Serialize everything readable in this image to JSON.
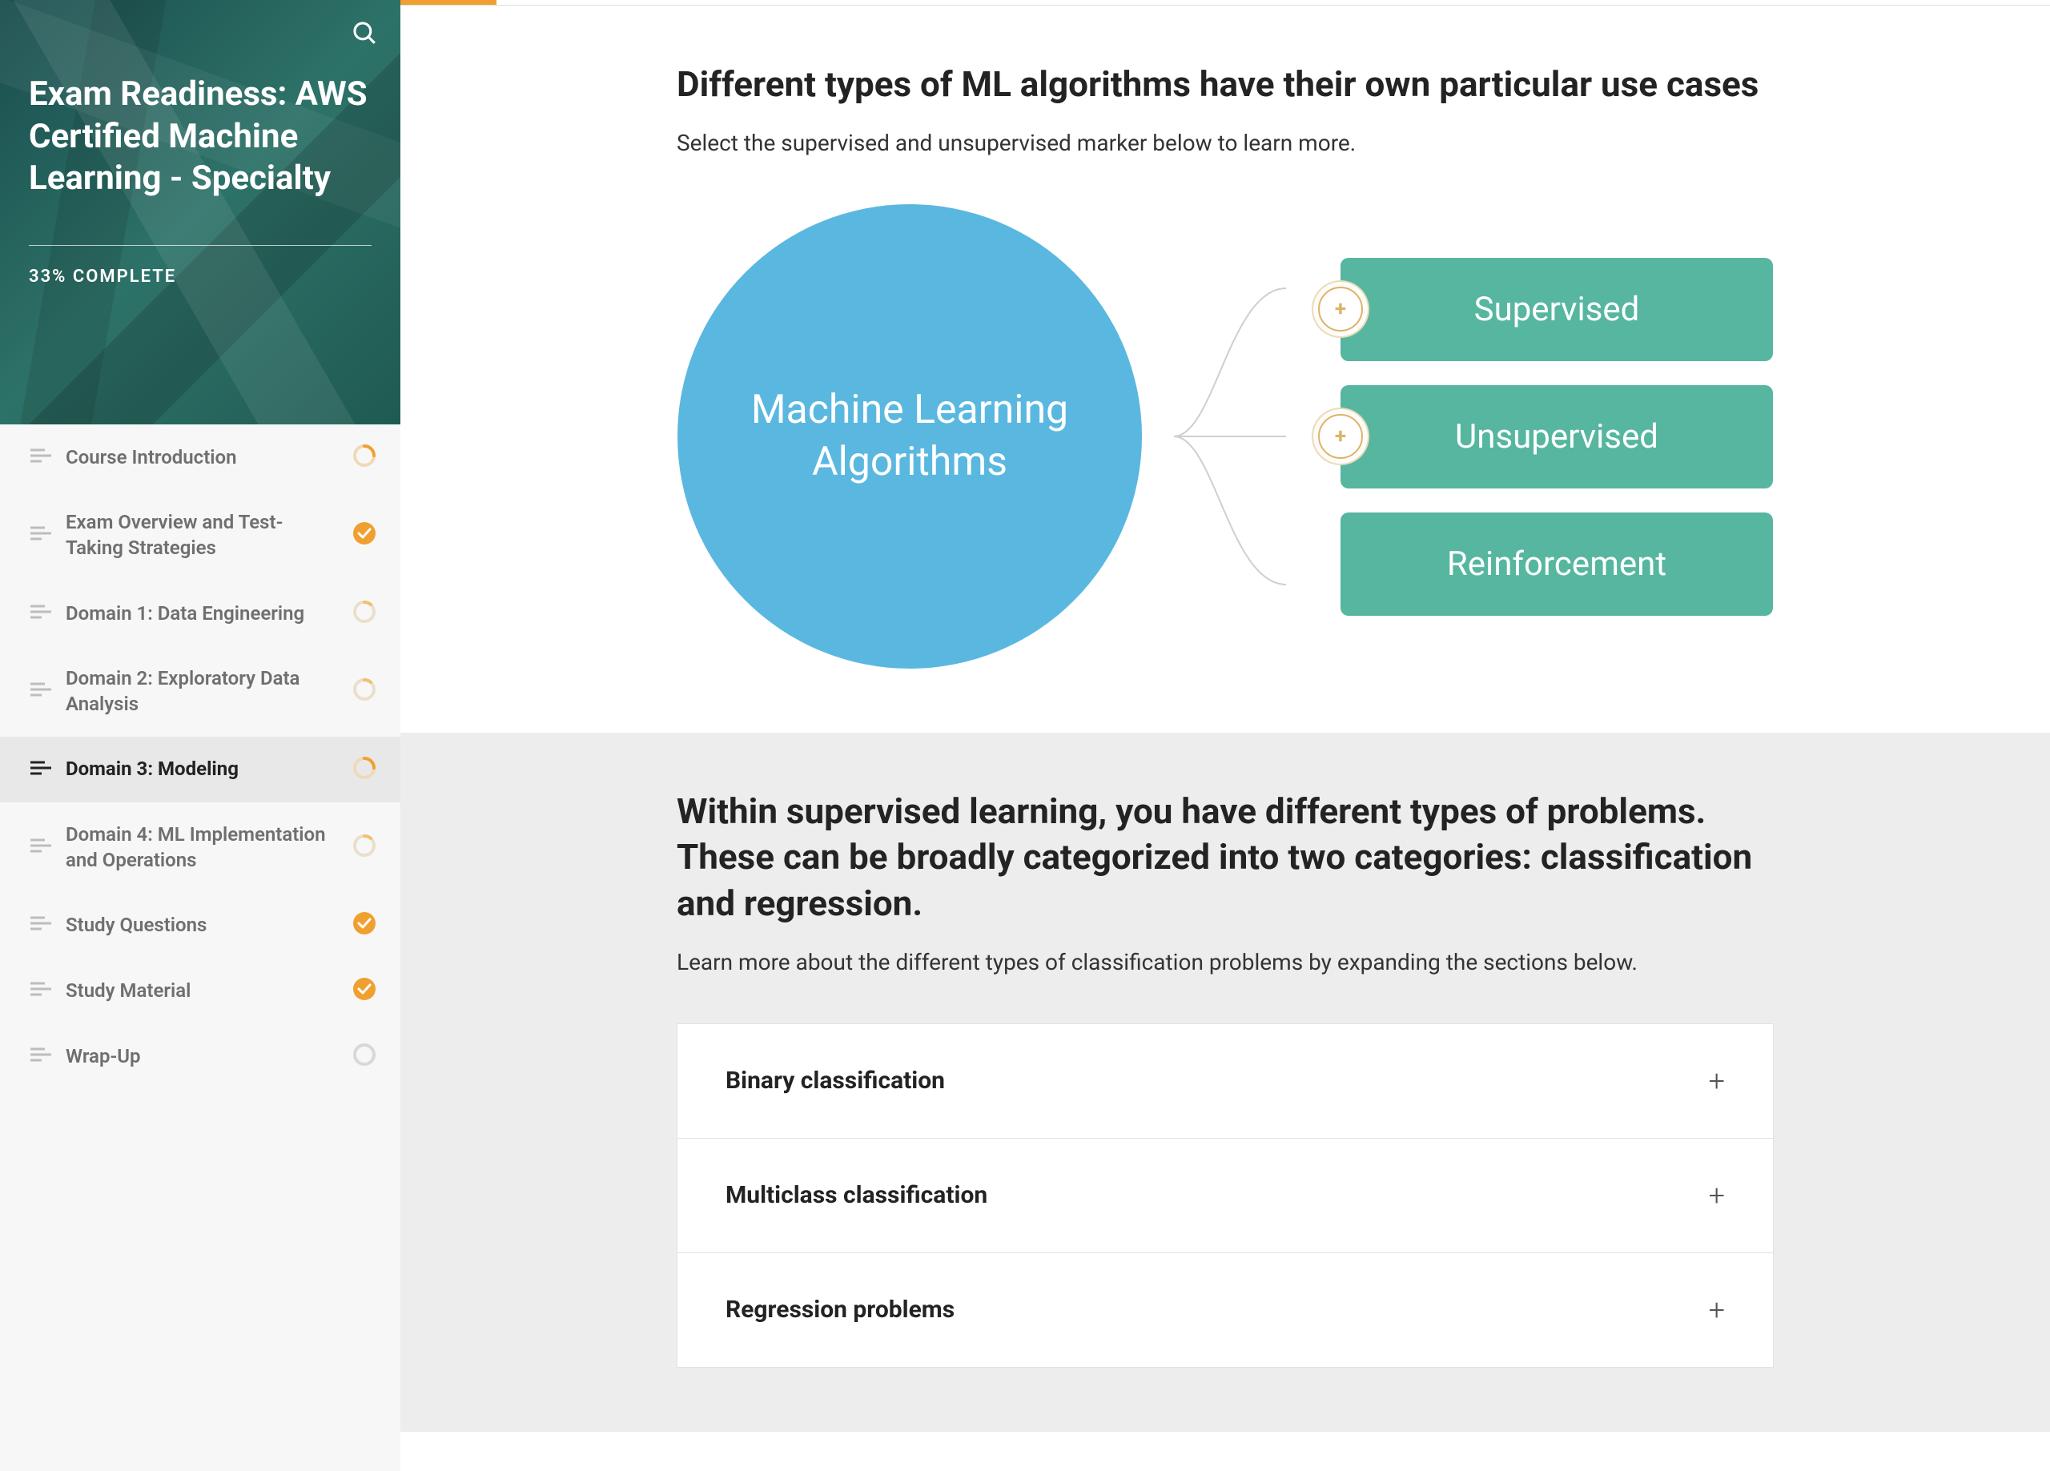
{
  "sidebar": {
    "course_title": "Exam Readiness: AWS Certified Machine Learning - Specialty",
    "progress": "33% COMPLETE",
    "items": [
      {
        "label": "Course Introduction",
        "status": "partial"
      },
      {
        "label": "Exam Overview and Test-Taking Strategies",
        "status": "complete"
      },
      {
        "label": "Domain 1: Data Engineering",
        "status": "partial-faint"
      },
      {
        "label": "Domain 2: Exploratory Data Analysis",
        "status": "partial-faint"
      },
      {
        "label": "Domain 3: Modeling",
        "status": "partial",
        "active": true
      },
      {
        "label": "Domain 4: ML Implementation and Operations",
        "status": "partial-faint"
      },
      {
        "label": "Study Questions",
        "status": "complete"
      },
      {
        "label": "Study Material",
        "status": "complete"
      },
      {
        "label": "Wrap-Up",
        "status": "empty"
      }
    ]
  },
  "main": {
    "section1": {
      "title": "Different types of ML algorithms have their own particular use cases",
      "subtitle": "Select the supervised and unsupervised marker below to learn more.",
      "circle": "Machine Learning Algorithms",
      "cat1": "Supervised",
      "cat2": "Unsupervised",
      "cat3": "Reinforcement"
    },
    "section2": {
      "title": "Within supervised learning, you have different types of problems. These can be broadly categorized into two categories: classification and regression.",
      "subtitle": "Learn more about the different types of classification problems by expanding the sections below.",
      "acc": [
        "Binary classification",
        "Multiclass classification",
        "Regression problems"
      ]
    }
  }
}
